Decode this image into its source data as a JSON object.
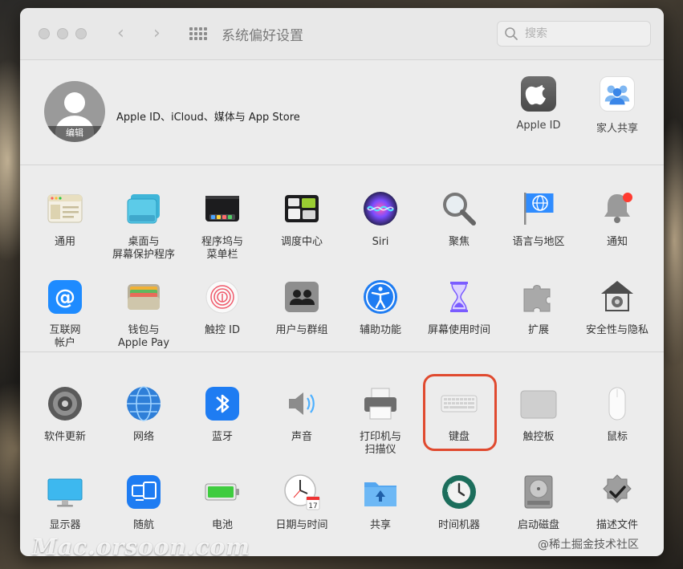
{
  "window": {
    "title": "系统偏好设置",
    "back_glyph": "‹",
    "forward_glyph": "›",
    "search_placeholder": "搜索"
  },
  "account": {
    "label": "Apple ID、iCloud、媒体与 App Store",
    "edit_label": "编辑",
    "top_items": [
      {
        "label": "Apple ID",
        "icon": "apple-logo-icon"
      },
      {
        "label": "家人共享",
        "icon": "family-sharing-icon"
      }
    ]
  },
  "section1": [
    {
      "label": "通用",
      "icon": "general-icon"
    },
    {
      "label": "桌面与\n屏幕保护程序",
      "icon": "desktop-screensaver-icon"
    },
    {
      "label": "程序坞与\n菜单栏",
      "icon": "dock-menubar-icon"
    },
    {
      "label": "调度中心",
      "icon": "mission-control-icon"
    },
    {
      "label": "Siri",
      "icon": "siri-icon"
    },
    {
      "label": "聚焦",
      "icon": "spotlight-icon"
    },
    {
      "label": "语言与地区",
      "icon": "language-region-icon"
    },
    {
      "label": "通知",
      "icon": "notifications-icon"
    },
    {
      "label": "互联网\n帐户",
      "icon": "internet-accounts-icon"
    },
    {
      "label": "钱包与\nApple Pay",
      "icon": "wallet-icon"
    },
    {
      "label": "触控 ID",
      "icon": "touch-id-icon"
    },
    {
      "label": "用户与群组",
      "icon": "users-groups-icon"
    },
    {
      "label": "辅助功能",
      "icon": "accessibility-icon"
    },
    {
      "label": "屏幕使用时间",
      "icon": "screen-time-icon"
    },
    {
      "label": "扩展",
      "icon": "extensions-icon"
    },
    {
      "label": "安全性与隐私",
      "icon": "security-privacy-icon"
    }
  ],
  "section2": [
    {
      "label": "软件更新",
      "icon": "software-update-icon"
    },
    {
      "label": "网络",
      "icon": "network-icon"
    },
    {
      "label": "蓝牙",
      "icon": "bluetooth-icon"
    },
    {
      "label": "声音",
      "icon": "sound-icon"
    },
    {
      "label": "打印机与\n扫描仪",
      "icon": "printers-scanners-icon"
    },
    {
      "label": "键盘",
      "icon": "keyboard-icon"
    },
    {
      "label": "触控板",
      "icon": "trackpad-icon"
    },
    {
      "label": "鼠标",
      "icon": "mouse-icon"
    },
    {
      "label": "显示器",
      "icon": "displays-icon"
    },
    {
      "label": "随航",
      "icon": "sidecar-icon"
    },
    {
      "label": "电池",
      "icon": "battery-icon"
    },
    {
      "label": "日期与时间",
      "icon": "date-time-icon"
    },
    {
      "label": "共享",
      "icon": "sharing-icon"
    },
    {
      "label": "时间机器",
      "icon": "time-machine-icon"
    },
    {
      "label": "启动磁盘",
      "icon": "startup-disk-icon"
    },
    {
      "label": "描述文件",
      "icon": "profiles-icon"
    }
  ],
  "calendar_day": "17",
  "highlighted_item": "键盘",
  "watermark": "Mac.orsoon.com",
  "attribution": "@稀土掘金技术社区",
  "colors": {
    "highlight": "#e04a2f",
    "window_bg": "#ececec"
  }
}
